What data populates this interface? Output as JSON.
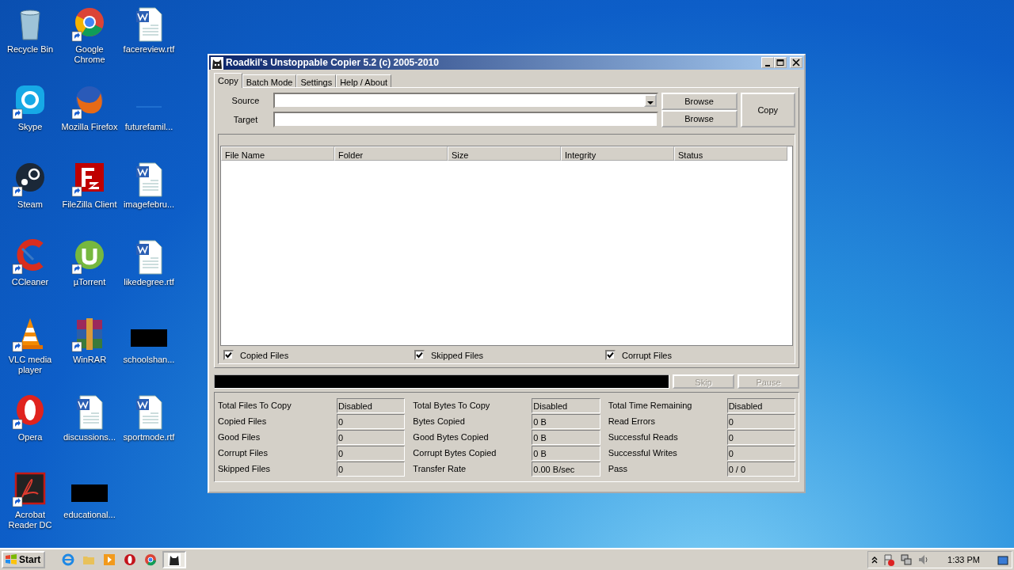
{
  "desktop_icons": [
    {
      "label": "Recycle Bin",
      "kind": "bin",
      "shortcut": false
    },
    {
      "label": "Google Chrome",
      "kind": "chrome",
      "shortcut": true
    },
    {
      "label": "facereview.rtf",
      "kind": "word",
      "shortcut": false
    },
    {
      "label": "Skype",
      "kind": "skype",
      "shortcut": true
    },
    {
      "label": "Mozilla Firefox",
      "kind": "firefox",
      "shortcut": true
    },
    {
      "label": "futurefamil...",
      "kind": "blank",
      "shortcut": false
    },
    {
      "label": "Steam",
      "kind": "steam",
      "shortcut": true
    },
    {
      "label": "FileZilla Client",
      "kind": "filezilla",
      "shortcut": true
    },
    {
      "label": "imagefebru...",
      "kind": "word",
      "shortcut": false
    },
    {
      "label": "CCleaner",
      "kind": "ccleaner",
      "shortcut": true
    },
    {
      "label": "µTorrent",
      "kind": "utorrent",
      "shortcut": true
    },
    {
      "label": "likedegree.rtf",
      "kind": "word",
      "shortcut": false
    },
    {
      "label": "VLC media player",
      "kind": "vlc",
      "shortcut": true
    },
    {
      "label": "WinRAR",
      "kind": "winrar",
      "shortcut": true
    },
    {
      "label": "schoolshan...",
      "kind": "redacted",
      "shortcut": false
    },
    {
      "label": "Opera",
      "kind": "opera",
      "shortcut": true
    },
    {
      "label": "discussions...",
      "kind": "word",
      "shortcut": false
    },
    {
      "label": "sportmode.rtf",
      "kind": "word",
      "shortcut": false
    },
    {
      "label": "Acrobat Reader DC",
      "kind": "acrobat",
      "shortcut": true
    },
    {
      "label": "educational...",
      "kind": "redacted",
      "shortcut": false
    }
  ],
  "window": {
    "title": "Roadkil's Unstoppable Copier 5.2 (c) 2005-2010",
    "tabs": [
      {
        "label": "Copy",
        "selected": true
      },
      {
        "label": "Batch Mode",
        "selected": false
      },
      {
        "label": "Settings",
        "selected": false
      },
      {
        "label": "Help / About",
        "selected": false
      }
    ],
    "source_label": "Source",
    "target_label": "Target",
    "browse_buttons": [
      "Browse",
      "Browse"
    ],
    "copy_button": "Copy",
    "table": {
      "columns": [
        "File Name",
        "Folder",
        "Size",
        "Integrity",
        "Status"
      ]
    },
    "filters": [
      {
        "label": "Copied Files",
        "checked": true
      },
      {
        "label": "Skipped Files",
        "checked": true
      },
      {
        "label": "Corrupt Files",
        "checked": true
      }
    ],
    "progress": {
      "level": 0
    },
    "actions": [
      {
        "label": "Skip",
        "disabled": true
      },
      {
        "label": "Pause",
        "disabled": true
      }
    ],
    "stats": [
      [
        {
          "label": "Total Files To Copy",
          "value": "Disabled"
        },
        {
          "label": "Copied Files",
          "value": "0"
        },
        {
          "label": "Good Files",
          "value": "0"
        },
        {
          "label": "Corrupt Files",
          "value": "0"
        },
        {
          "label": "Skipped Files",
          "value": "0"
        }
      ],
      [
        {
          "label": "Total Bytes To Copy",
          "value": "Disabled"
        },
        {
          "label": "Bytes Copied",
          "value": "0 B"
        },
        {
          "label": "Good Bytes Copied",
          "value": "0 B"
        },
        {
          "label": "Corrupt Bytes Copied",
          "value": "0 B"
        },
        {
          "label": "Transfer Rate",
          "value": "0.00 B/sec"
        }
      ],
      [
        {
          "label": "Total Time Remaining",
          "value": "Disabled"
        },
        {
          "label": "Read Errors",
          "value": "0"
        },
        {
          "label": "Successful Reads",
          "value": "0"
        },
        {
          "label": "Successful Writes",
          "value": "0"
        },
        {
          "label": "Pass",
          "value": "0 / 0"
        }
      ]
    ]
  },
  "taskbar": {
    "start": "Start",
    "quick_launch": [
      {
        "kind": "ie"
      },
      {
        "kind": "folder"
      },
      {
        "kind": "media"
      },
      {
        "kind": "opera"
      },
      {
        "kind": "chrome"
      },
      {
        "kind": "copier",
        "selected": true
      }
    ],
    "clock": "1:33 PM"
  }
}
